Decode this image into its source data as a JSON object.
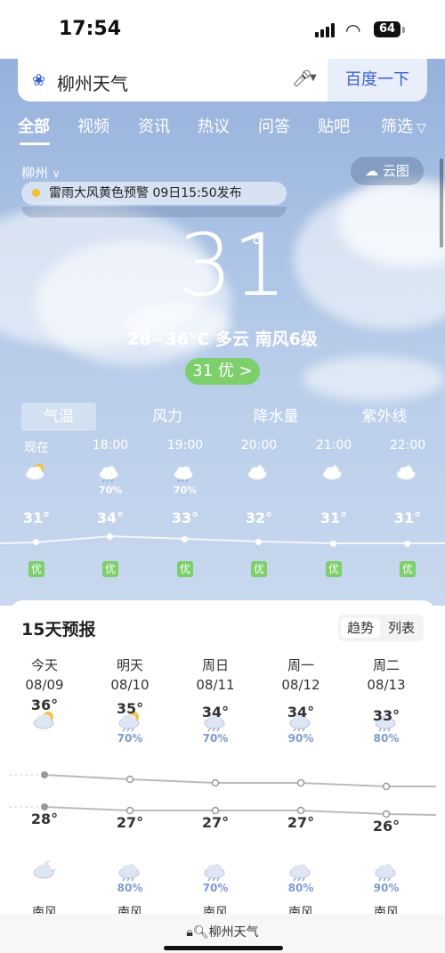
{
  "status": {
    "time": "17:54",
    "battery": "64"
  },
  "search": {
    "query": "柳州天气",
    "button": "百度一下"
  },
  "tabs": [
    "全部",
    "视频",
    "资讯",
    "热议",
    "问答",
    "贴吧",
    "筛选"
  ],
  "location": "柳州",
  "cloud_map": "云图",
  "alert": {
    "text": "雷雨大风黄色预警  09日15:50发布"
  },
  "current": {
    "temp": "31",
    "deg": "°",
    "summary": "28~36°C  多云  南风6级",
    "aqi": "31 优 >"
  },
  "hour_tabs": [
    "气温",
    "风力",
    "降水量",
    "紫外线"
  ],
  "hours": [
    {
      "time": "现在",
      "icon": "sun-cloud-icon",
      "pct": "",
      "temp": "31°",
      "aqi": "优"
    },
    {
      "time": "18:00",
      "icon": "rain-cloud-icon",
      "pct": "70%",
      "temp": "34°",
      "aqi": "优"
    },
    {
      "time": "19:00",
      "icon": "rain-cloud-icon",
      "pct": "70%",
      "temp": "33°",
      "aqi": "优"
    },
    {
      "time": "20:00",
      "icon": "moon-cloud-icon",
      "pct": "",
      "temp": "32°",
      "aqi": "优"
    },
    {
      "time": "21:00",
      "icon": "moon-cloud-icon",
      "pct": "",
      "temp": "31°",
      "aqi": "优"
    },
    {
      "time": "22:00",
      "icon": "moon-cloud-icon",
      "pct": "",
      "temp": "31°",
      "aqi": "优"
    }
  ],
  "forecast": {
    "title": "15天预报",
    "toggle": [
      "趋势",
      "列表"
    ],
    "days": [
      {
        "name": "今天",
        "date": "08/09",
        "icon": "sun-cloud-icon",
        "pct": "",
        "hi": "36°",
        "lo": "28°",
        "night_icon": "moon-cloud-icon",
        "night_pct": "",
        "wind": "南风"
      },
      {
        "name": "明天",
        "date": "08/10",
        "icon": "sun-rain-icon",
        "pct": "70%",
        "hi": "35°",
        "lo": "27°",
        "night_icon": "rain-cloud-icon",
        "night_pct": "80%",
        "wind": "南风"
      },
      {
        "name": "周日",
        "date": "08/11",
        "icon": "rain-cloud-icon",
        "pct": "70%",
        "hi": "34°",
        "lo": "27°",
        "night_icon": "rain-cloud-icon",
        "night_pct": "70%",
        "wind": "南风"
      },
      {
        "name": "周一",
        "date": "08/12",
        "icon": "rain-cloud-icon",
        "pct": "90%",
        "hi": "34°",
        "lo": "27°",
        "night_icon": "rain-cloud-icon",
        "night_pct": "80%",
        "wind": "南风"
      },
      {
        "name": "周二",
        "date": "08/13",
        "icon": "rain-cloud-icon",
        "pct": "80%",
        "hi": "33°",
        "lo": "26°",
        "night_icon": "rain-cloud-icon",
        "night_pct": "90%",
        "wind": "南风"
      }
    ]
  },
  "bottom": {
    "url": "柳州天气"
  }
}
